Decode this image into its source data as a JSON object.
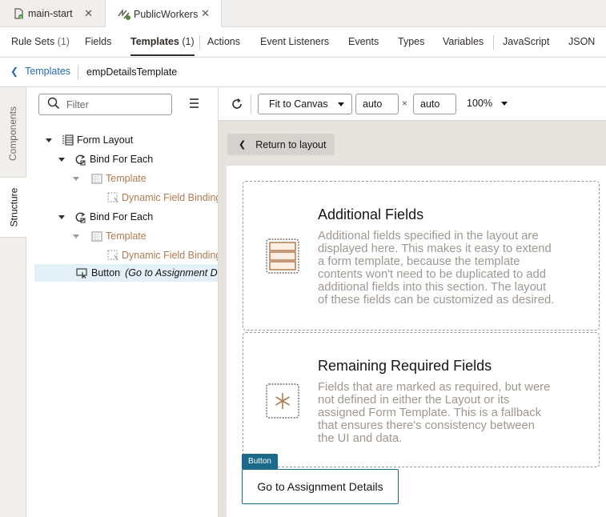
{
  "file_tabs": [
    {
      "label": "main-start",
      "icon": "git-branch-icon",
      "active": false
    },
    {
      "label": "PublicWorkers",
      "icon": "workers-app-icon",
      "active": true
    }
  ],
  "editor_tabs": {
    "rule_sets": {
      "label": "Rule Sets",
      "count": "(1)"
    },
    "fields": "Fields",
    "templates": {
      "label": "Templates",
      "count": "(1)"
    },
    "actions": "Actions",
    "event_listeners": "Event Listeners",
    "events": "Events",
    "types": "Types",
    "variables": "Variables",
    "javascript": "JavaScript",
    "json": "JSON"
  },
  "breadcrumb": {
    "back_label": "Templates",
    "current": "empDetailsTemplate"
  },
  "side_tabs": {
    "components": "Components",
    "structure": "Structure"
  },
  "structure": {
    "filter_placeholder": "Filter",
    "tree": [
      {
        "label": "Form Layout",
        "icon": "form-layout-icon"
      },
      {
        "label": "Bind For Each",
        "icon": "bind-for-each-icon"
      },
      {
        "label": "Template",
        "icon": "template-icon"
      },
      {
        "label": "Dynamic Field Binding",
        "icon": "dynamic-field-icon"
      },
      {
        "label": "Bind For Each",
        "icon": "bind-for-each-icon"
      },
      {
        "label": "Template",
        "icon": "template-icon"
      },
      {
        "label": "Dynamic Field Binding",
        "icon": "dynamic-field-icon"
      },
      {
        "label": "Button",
        "detail": "(Go to Assignment De",
        "icon": "button-icon",
        "selected": true
      }
    ]
  },
  "canvas_toolbar": {
    "fit_label": "Fit to Canvas",
    "width_value": "auto",
    "height_value": "auto",
    "times": "×",
    "zoom": "100%"
  },
  "canvas": {
    "return_label": "Return to layout",
    "additional": {
      "title": "Additional Fields",
      "lines": [
        "Additional fields specified in the layout are",
        "displayed here. This makes it easy to extend",
        "a form template, because the template",
        "contents won't need to be duplicated to add",
        "additional fields into this section. The layout",
        "of these fields can be customized as desired."
      ]
    },
    "remaining": {
      "title": "Remaining Required Fields",
      "lines": [
        "Fields that are marked as required, but were",
        "not defined in either the Layout or its",
        "assigned Form Template. This is a fallback",
        "that ensures there's consistency between",
        "the UI and data."
      ]
    },
    "button_badge": "Button",
    "button_label": "Go to Assignment Details"
  },
  "colors": {
    "accent": "#1b6a8a",
    "link": "#2a6bb0",
    "icon_orange": "#b07b51",
    "selected_row": "#e4f0f8"
  }
}
